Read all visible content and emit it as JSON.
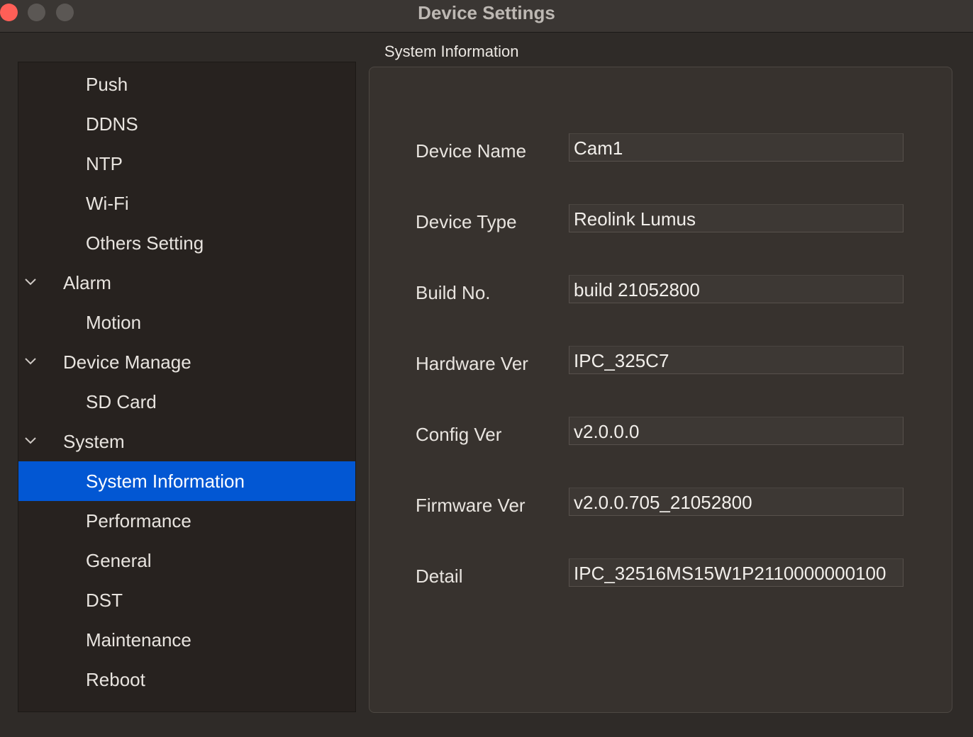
{
  "window": {
    "title": "Device Settings"
  },
  "sidebar": {
    "items": [
      {
        "label": "Push"
      },
      {
        "label": "DDNS"
      },
      {
        "label": "NTP"
      },
      {
        "label": "Wi-Fi"
      },
      {
        "label": "Others Setting"
      },
      {
        "label": "Alarm",
        "expanded": true
      },
      {
        "label": "Motion"
      },
      {
        "label": "Device Manage",
        "expanded": true
      },
      {
        "label": "SD Card"
      },
      {
        "label": "System",
        "expanded": true
      },
      {
        "label": "System Information",
        "selected": true
      },
      {
        "label": "Performance"
      },
      {
        "label": "General"
      },
      {
        "label": "DST"
      },
      {
        "label": "Maintenance"
      },
      {
        "label": "Reboot"
      }
    ]
  },
  "main": {
    "section_title": "System Information",
    "fields": [
      {
        "label": "Device Name",
        "value": "Cam1"
      },
      {
        "label": "Device Type",
        "value": "Reolink Lumus"
      },
      {
        "label": "Build No.",
        "value": "build 21052800"
      },
      {
        "label": "Hardware Ver",
        "value": "IPC_325C7"
      },
      {
        "label": "Config Ver",
        "value": "v2.0.0.0"
      },
      {
        "label": "Firmware Ver",
        "value": "v2.0.0.705_21052800"
      },
      {
        "label": "Detail",
        "value": "IPC_32516MS15W1P2110000000100"
      }
    ]
  },
  "colors": {
    "selection": "#0257d3",
    "close_button": "#fe5f57"
  },
  "icons": {
    "group_expander": "chevron-down-icon"
  }
}
